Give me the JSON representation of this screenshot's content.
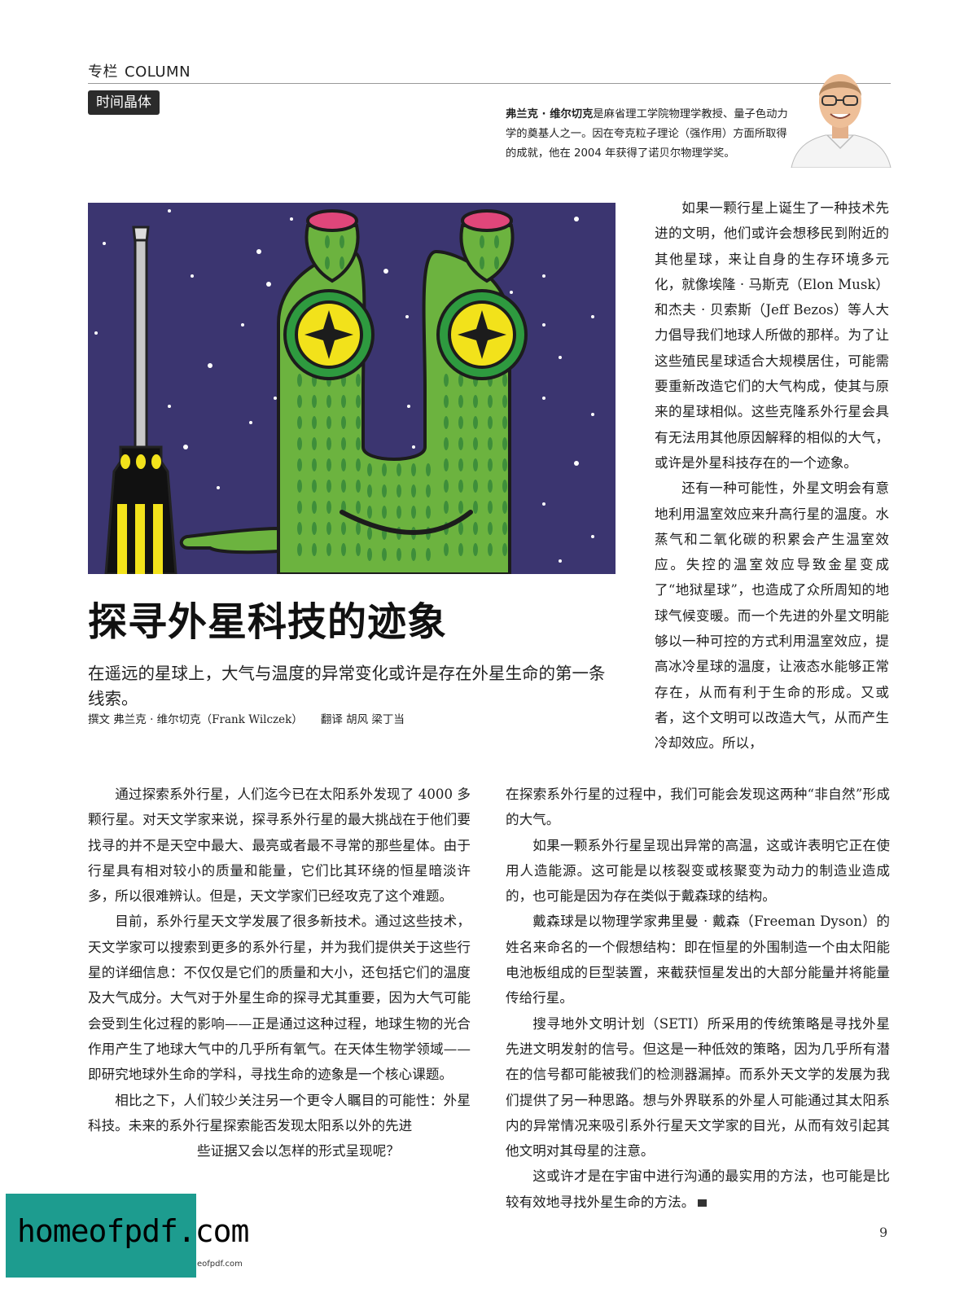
{
  "header": {
    "column_cn": "专栏",
    "column_en": "COLUMN",
    "series_tag": "时间晶体"
  },
  "author_bio": {
    "name": "弗兰克 · 维尔切克",
    "text": "是麻省理工学院物理学教授、量子色动力学的奠基人之一。因在夸克粒子理论（强作用）方面所取得的成就，他在 2004 年获得了诺贝尔物理学奖。"
  },
  "article": {
    "title": "探寻外星科技的迹象",
    "deck": "在遥远的星球上，大气与温度的异常变化或许是存在外星生命的第一条线索。",
    "byline_author": "撰文  弗兰克 · 维尔切克（Frank Wilczek）",
    "byline_translators": "翻译  胡风  梁丁当"
  },
  "body": {
    "right_top": [
      "如果一颗行星上诞生了一种技术先进的文明，他们或许会想移民到附近的其他星球，来让自身的生存环境多元化，就像埃隆 · 马斯克（Elon Musk）和杰夫 · 贝索斯（Jeff Bezos）等人大力倡导我们地球人所做的那样。为了让这些殖民星球适合大规模居住，可能需要重新改造它们的大气构成，使其与原来的星球相似。这些克隆系外行星会具有无法用其他原因解释的相似的大气，或许是外星科技存在的一个迹象。",
      "还有一种可能性，外星文明会有意地利用温室效应来升高行星的温度。水蒸气和二氧化碳的积累会产生温室效应。失控的温室效应导致金星变成了“地狱星球”，也造成了众所周知的地球气候变暖。而一个先进的外星文明能够以一种可控的方式利用温室效应，提高冰冷星球的温度，让液态水能够正常存在，从而有利于生命的形成。又或者，这个文明可以改造大气，从而产生冷却效应。所以，"
    ],
    "left": [
      "通过探索系外行星，人们迄今已在太阳系外发现了 4000 多颗行星。对天文学家来说，探寻系外行星的最大挑战在于他们要找寻的并不是天空中最大、最亮或者最不寻常的那些星体。由于行星具有相对较小的质量和能量，它们比其环绕的恒星暗淡许多，所以很难辨认。但是，天文学家们已经攻克了这个难题。",
      "目前，系外行星天文学发展了很多新技术。通过这些技术，天文学家可以搜索到更多的系外行星，并为我们提供关于这些行星的详细信息：不仅仅是它们的质量和大小，还包括它们的温度及大气成分。大气对于外星生命的探寻尤其重要，因为大气可能会受到生化过程的影响——正是通过这种过程，地球生物的光合作用产生了地球大气中的几乎所有氧气。在天体生物学领域——即研究地球外生命的学科，寻找生命的迹象是一个核心课题。",
      "相比之下，人们较少关注另一个更令人瞩目的可能性：外星科技。未来的系外行星探索能否发现太阳系以外的先进",
      "些证据又会以怎样的形式呈现呢？"
    ],
    "right_bottom": [
      "在探索系外行星的过程中，我们可能会发现这两种“非自然”形成的大气。",
      "如果一颗系外行星呈现出异常的高温，这或许表明它正在使用人造能源。这可能是以核裂变或核聚变为动力的制造业造成的，也可能是因为存在类似于戴森球的结构。",
      "戴森球是以物理学家弗里曼 · 戴森（Freeman Dyson）的姓名来命名的一个假想结构：即在恒星的外围制造一个由太阳能电池板组成的巨型装置，来截获恒星发出的大部分能量并将能量传给行星。",
      "搜寻地外文明计划（SETI）所采用的传统策略是寻找外星先进文明发射的信号。但这是一种低效的策略，因为几乎所有潜在的信号都可能被我们的检测器漏掉。而系外天文学的发展为我们提供了另一种思路。想与外界联系的外星人可能通过其太阳系内的异常情况来吸引系外行星天文学家的目光，从而有效引起其他文明对其母星的注意。",
      "这或许才是在宇宙中进行沟通的最实用的方法，也可能是比较有效地寻找外星生命的方法。"
    ]
  },
  "footer": {
    "page_number": "9",
    "watermark": "homeofpdf.com",
    "watermark_url": "eofpdf.com"
  },
  "colors": {
    "sky": "#3b3570",
    "alien_green": "#6cb33f",
    "alien_spots": "#3e8e3a",
    "tip_pink": "#e0467a",
    "eye_yellow": "#f2e21b",
    "watermark": "#1d9c8f"
  },
  "icons": [
    "portrait-photo",
    "alien-illustration",
    "screwdriver",
    "end-mark-icon"
  ]
}
